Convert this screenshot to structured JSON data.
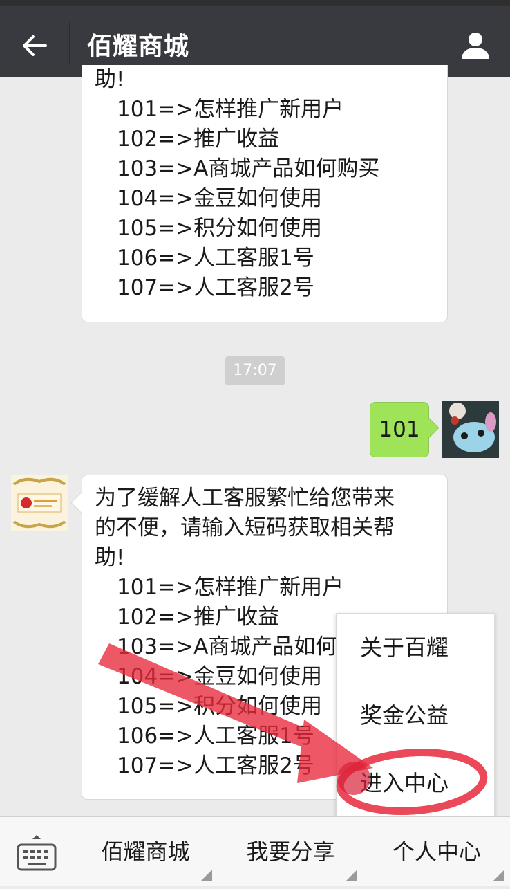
{
  "header": {
    "title": "佰耀商城",
    "back_icon": "arrow-left-icon",
    "profile_icon": "person-icon"
  },
  "messages": {
    "first_partial": {
      "intro_tail": "助!",
      "items": [
        "101=>怎样推广新用户",
        "102=>推广收益",
        "103=>A商城产品如何购买",
        "104=>金豆如何使用",
        "105=>积分如何使用",
        "106=>人工客服1号",
        "107=>人工客服2号"
      ]
    },
    "timestamp": "17:07",
    "sent_text": "101",
    "reply": {
      "intro_line1": "为了缓解人工客服繁忙给您带来",
      "intro_line2": "的不便，请输入短码获取相关帮",
      "intro_line3": "助!",
      "items": [
        "101=>怎样推广新用户",
        "102=>推广收益",
        "103=>A商城产品如何购买",
        "104=>金豆如何使用",
        "105=>积分如何使用",
        "106=>人工客服1号",
        "107=>人工客服2号"
      ]
    }
  },
  "popup_menu": {
    "items": [
      "关于百耀",
      "奖金公益",
      "进入中心"
    ]
  },
  "bottom_menu": {
    "keyboard_icon": "keyboard-icon",
    "tabs": [
      "佰耀商城",
      "我要分享",
      "个人中心"
    ]
  },
  "colors": {
    "titlebar": "#393a3f",
    "sent_bubble": "#9fe358",
    "annotation": "#e8293c"
  }
}
